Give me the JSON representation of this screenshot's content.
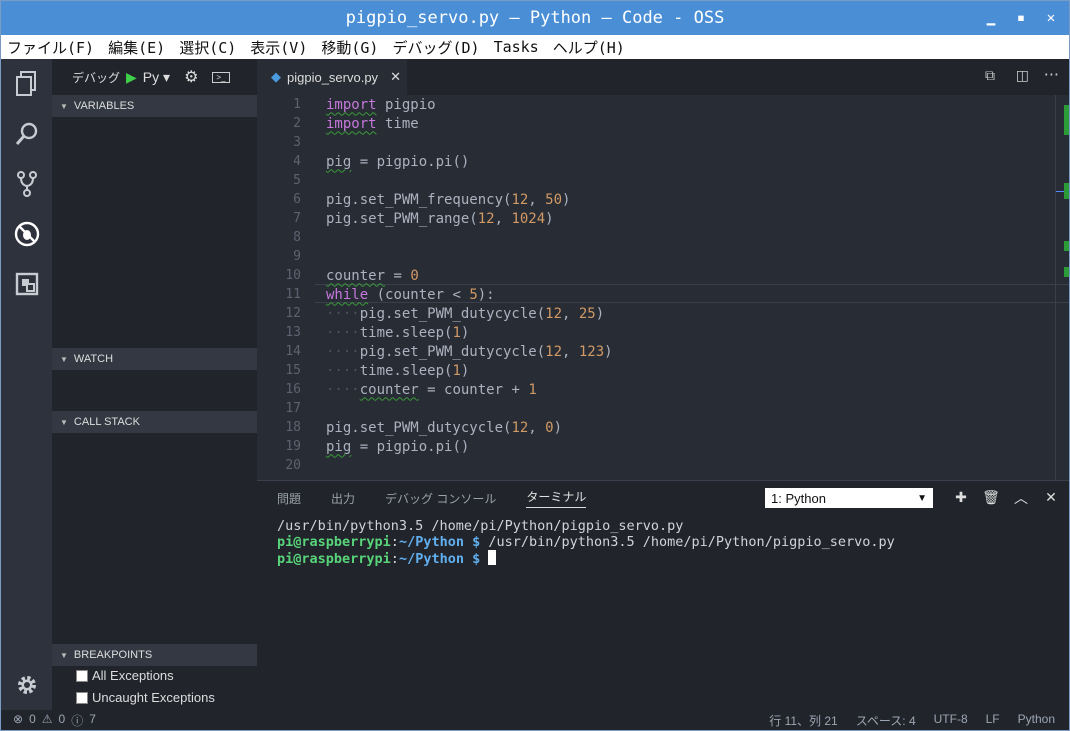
{
  "window": {
    "title": "pigpio_servo.py — Python — Code - OSS"
  },
  "menu": [
    "ファイル(F)",
    "編集(E)",
    "選択(C)",
    "表示(V)",
    "移動(G)",
    "デバッグ(D)",
    "Tasks",
    "ヘルプ(H)"
  ],
  "debug": {
    "label": "デバッグ",
    "config": "Py"
  },
  "sidebar": {
    "variables": "VARIABLES",
    "watch": "WATCH",
    "callstack": "CALL STACK",
    "breakpoints": "BREAKPOINTS",
    "bp_items": [
      "All Exceptions",
      "Uncaught Exceptions"
    ]
  },
  "tab": {
    "filename": "pigpio_servo.py"
  },
  "panel": {
    "tabs": [
      "問題",
      "出力",
      "デバッグ コンソール",
      "ターミナル"
    ],
    "terminal_select": "1: Python",
    "term": {
      "line1": "/usr/bin/python3.5 /home/pi/Python/pigpio_servo.py",
      "user": "pi@raspberrypi",
      "sep": ":",
      "path": "~/Python $",
      "cmd": " /usr/bin/python3.5 /home/pi/Python/pigpio_servo.py"
    }
  },
  "status": {
    "errors": "0",
    "warnings": "0",
    "info": "7",
    "position": "行 11、列 21",
    "spaces": "スペース: 4",
    "encoding": "UTF-8",
    "eol": "LF",
    "language": "Python"
  }
}
